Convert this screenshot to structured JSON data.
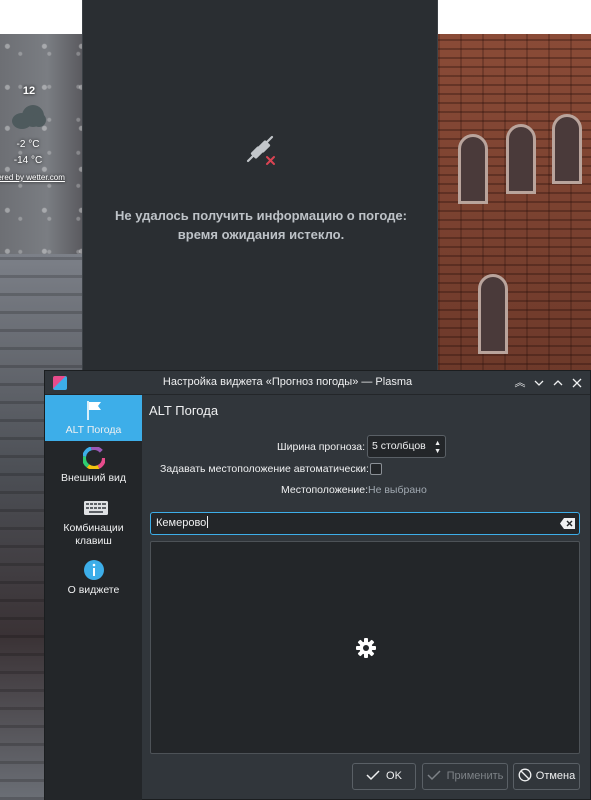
{
  "desktop_widget": {
    "day": "12",
    "temp_high": "-2 °C",
    "temp_low": "-14 °C",
    "credit": "owered by wetter.com",
    "icon": "cloud-icon"
  },
  "popup": {
    "message_line1": "Не удалось получить информацию о погоде:",
    "message_line2": "время ожидания истекло.",
    "icon": "network-disconnect-icon"
  },
  "dialog": {
    "title": "Настройка виджета «Прогноз погоды» — Plasma",
    "titlebar_buttons": [
      "keep-above",
      "minimize",
      "maximize",
      "close"
    ],
    "sidebar": [
      {
        "label": "ALT Погода",
        "icon": "flag-icon",
        "active": true
      },
      {
        "label": "Внешний вид",
        "icon": "color-wheel-icon",
        "active": false
      },
      {
        "label": "Комбинации клавиш",
        "icon": "keyboard-icon",
        "active": false
      },
      {
        "label": "О виджете",
        "icon": "info-icon",
        "active": false
      }
    ],
    "page_title": "ALT Погода",
    "forecast_width_label": "Ширина прогноза:",
    "forecast_width_value": "5 столбцов",
    "auto_location_label": "Задавать местоположение автоматически:",
    "auto_location_checked": false,
    "location_label": "Местоположение:",
    "location_value": "Не выбрано",
    "search_value": "Кемерово",
    "buttons": {
      "ok": "OK",
      "apply": "Применить",
      "cancel": "Отмена"
    },
    "accent_color": "#3daee9"
  }
}
